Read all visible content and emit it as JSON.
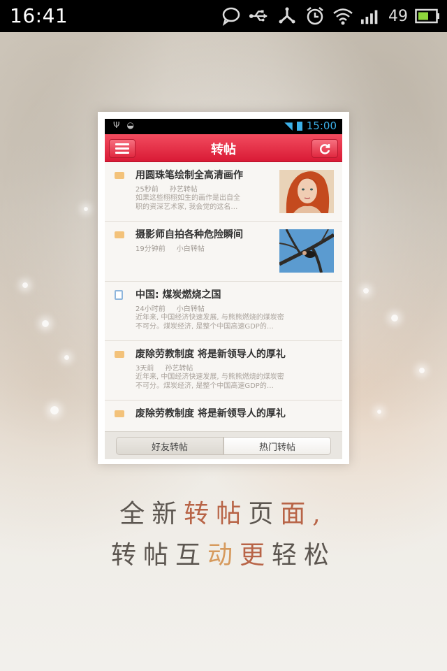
{
  "status_bar": {
    "time": "16:41",
    "battery_level": "49",
    "icons": [
      "chat-bubble-icon",
      "usb-icon",
      "debug-icon",
      "alarm-icon",
      "wifi-icon",
      "signal-icon",
      "battery-icon"
    ]
  },
  "mock": {
    "status_bar": {
      "time": "15:00"
    },
    "header": {
      "title": "转帖"
    },
    "items": [
      {
        "title": "用圆珠笔绘制全高清画作",
        "time": "25秒前",
        "author": "孙艺转帖",
        "desc1": "如果这些栩栩如生的画作是出自全",
        "desc2": "职的资深艺术家, 我会觉的这名…",
        "thumbnail": "portrait-image"
      },
      {
        "title": "摄影师自拍各种危险瞬间",
        "time": "19分钟前",
        "author": "小白转帖",
        "thumbnail": "tree-climber-image"
      },
      {
        "title": "中国: 煤炭燃烧之国",
        "time": "24小时前",
        "author": "小白转帖",
        "desc1": "近年来, 中国经济快速发展, 与熊熊燃烧的煤炭密",
        "desc2": "不可分。煤炭经济, 是整个中国高速GDP的…"
      },
      {
        "title": "废除劳教制度 将是新领导人的厚礼",
        "time": "3天前",
        "author": "孙艺转帖",
        "desc1": "近年来, 中国经济快速发展, 与熊熊燃烧的煤炭密",
        "desc2": "不可分。煤炭经济, 是整个中国高速GDP的…"
      },
      {
        "title": "废除劳教制度 将是新领导人的厚礼"
      }
    ],
    "tabs": [
      {
        "label": "好友转帖"
      },
      {
        "label": "热门转帖"
      }
    ]
  },
  "slogan": {
    "line1": [
      "全新",
      "转帖",
      "页",
      "面,"
    ],
    "line2": [
      "转帖",
      "互",
      "动",
      "更",
      "轻",
      "松"
    ]
  },
  "colors": {
    "header_red": "#d91a35",
    "mock_time_blue": "#3cb0e8",
    "slogan_gray": "#5c5650",
    "slogan_red": "#b86447",
    "slogan_orange": "#d69a5d"
  }
}
